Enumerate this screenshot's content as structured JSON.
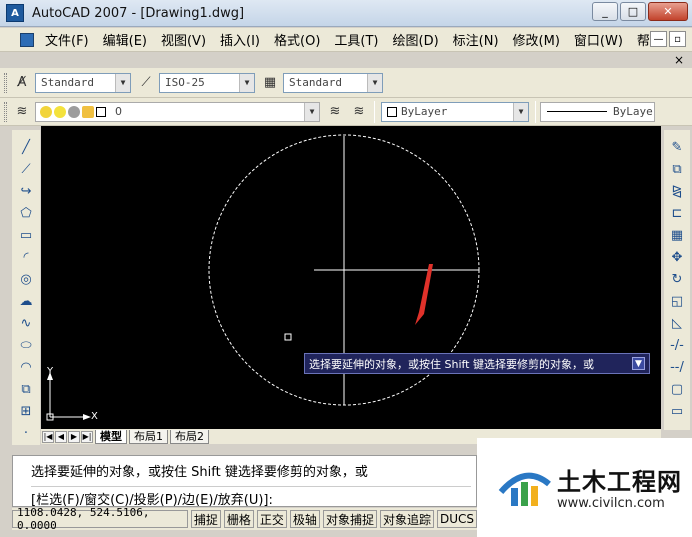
{
  "window": {
    "title": "AutoCAD 2007 - [Drawing1.dwg]",
    "logo": "app-logo-icon",
    "minimize": "_",
    "restore": "□",
    "close": "✕"
  },
  "menu": {
    "items": [
      "文件(F)",
      "编辑(E)",
      "视图(V)",
      "插入(I)",
      "格式(O)",
      "工具(T)",
      "绘图(D)",
      "标注(N)",
      "修改(M)",
      "窗口(W)",
      "帮助(H)"
    ],
    "doc_minimize": "—",
    "doc_restore": "▫",
    "doc_close": "×"
  },
  "styles_toolbar": {
    "text_style": "Standard",
    "dim_style": "ISO-25",
    "table_style": "Standard"
  },
  "layers_toolbar": {
    "current_layer": "0",
    "color": "ByLayer",
    "linetype": "ByLayer"
  },
  "tooltip": {
    "text": "选择要延伸的对象，或按住 Shift 键选择要修剪的对象，或"
  },
  "ucs": {
    "y_label": "Y",
    "x_label": "X"
  },
  "tabs": [
    "模型",
    "布局1",
    "布局2"
  ],
  "command": {
    "line1": "选择要延伸的对象，或按住 Shift 键选择要修剪的对象，或",
    "line2": "[栏选(F)/窗交(C)/投影(P)/边(E)/放弃(U)]:"
  },
  "status": {
    "coords": "1108.0428, 524.5106, 0.0000",
    "buttons": [
      "捕捉",
      "栅格",
      "正交",
      "极轴",
      "对象捕捉",
      "对象追踪",
      "DUCS"
    ]
  },
  "watermark": {
    "title": "土木工程网",
    "url": "www.civilcn.com"
  },
  "colors": {
    "canvas": "#000000",
    "tooltip_bg": "#20245b",
    "arrow": "#e0312a",
    "ui_face": "#ece9d8"
  }
}
